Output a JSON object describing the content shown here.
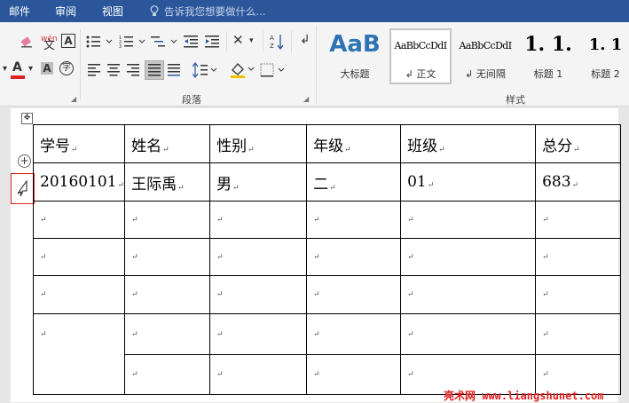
{
  "tabs": {
    "mailings": "邮件",
    "review": "审阅",
    "view": "视图"
  },
  "tell_me": {
    "placeholder": "告诉我您想要做什么..."
  },
  "ribbon": {
    "paragraph_group": "段落",
    "styles_group": "样式",
    "styles": [
      {
        "sample": "AaB",
        "name": "大标题"
      },
      {
        "sample": "AaBbCcDdI",
        "name": "↲ 正文"
      },
      {
        "sample": "AaBbCcDdI",
        "name": "↲ 无间隔"
      },
      {
        "sample": "1. 1.",
        "name": "标题 1"
      },
      {
        "sample": "1. 1",
        "name": "标题 2"
      }
    ],
    "phonetic_label": "wén",
    "enclose_label": "字",
    "font_color": "#e02020"
  },
  "table": {
    "header": [
      "学号",
      "姓名",
      "性别",
      "年级",
      "班级",
      "总分"
    ],
    "row1": [
      "20160101",
      "王际禹",
      "男",
      "二",
      "01",
      "683"
    ]
  },
  "watermark": "亮术网 www.liangshunet.com"
}
